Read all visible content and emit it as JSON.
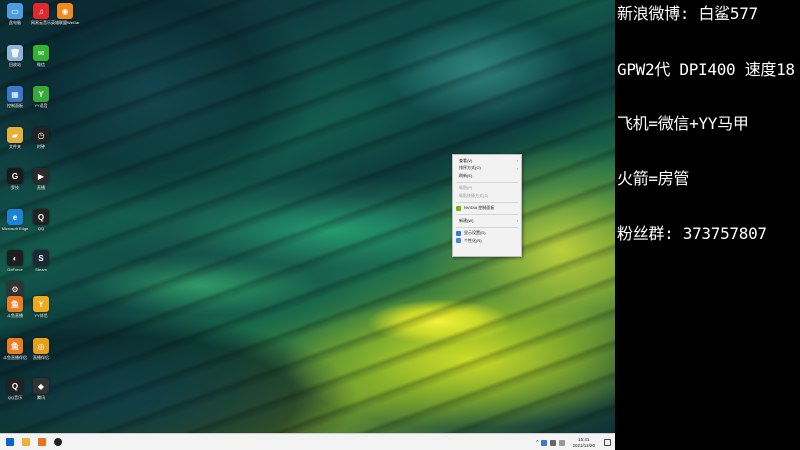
{
  "desktop": {
    "icons": [
      {
        "label": "此电脑",
        "color": "#4a9ee0",
        "glyph": "▭"
      },
      {
        "label": "网易云音乐",
        "color": "#e0282f",
        "glyph": "♫"
      },
      {
        "label": "英雄联盟WeGame",
        "color": "#f08a1c",
        "glyph": "◉"
      },
      {
        "label": "回收站",
        "color": "#8fb5d9",
        "glyph": "🗑"
      },
      {
        "label": "微信",
        "color": "#33b233",
        "glyph": "✉"
      },
      {
        "label": "控制面板",
        "color": "#3a78c8",
        "glyph": "▦"
      },
      {
        "label": "YY语音",
        "color": "#39a83a",
        "glyph": "Y"
      },
      {
        "label": "文件夹",
        "color": "#e2b13a",
        "glyph": "▰"
      },
      {
        "label": "时钟",
        "color": "#222",
        "glyph": "◷"
      },
      {
        "label": "罗技",
        "color": "#1a1a1a",
        "glyph": "G"
      },
      {
        "label": "直播",
        "color": "#2a2a2a",
        "glyph": "▶"
      },
      {
        "label": "Microsoft Edge",
        "color": "#1883d7",
        "glyph": "e"
      },
      {
        "label": "QQ",
        "color": "#222",
        "glyph": "Q"
      },
      {
        "label": "GeForce",
        "color": "#1e1e1e",
        "glyph": "◐"
      },
      {
        "label": "Steam",
        "color": "#1b2838",
        "glyph": "S"
      },
      {
        "label": "快捷方式",
        "color": "#333",
        "glyph": "⚙"
      },
      {
        "label": "斗鱼直播",
        "color": "#f07c22",
        "glyph": "鱼"
      },
      {
        "label": "YY伴侣",
        "color": "#f0a91c",
        "glyph": "Y"
      },
      {
        "label": "斗鱼直播伴侣",
        "color": "#f07c22",
        "glyph": "鱼"
      },
      {
        "label": "直播伴侣",
        "color": "#e8a01c",
        "glyph": "◎"
      },
      {
        "label": "QQ音乐",
        "color": "#222",
        "glyph": "Q"
      },
      {
        "label": "腾讯",
        "color": "#333",
        "glyph": "◆"
      }
    ]
  },
  "context_menu": {
    "items": [
      {
        "label": "查看(V)",
        "has_submenu": true,
        "disabled": false
      },
      {
        "label": "排序方式(O)",
        "has_submenu": true,
        "disabled": false
      },
      {
        "label": "刷新(E)",
        "has_submenu": false,
        "disabled": false
      },
      {
        "label": "粘贴(P)",
        "has_submenu": false,
        "disabled": true
      },
      {
        "label": "粘贴快捷方式(S)",
        "has_submenu": false,
        "disabled": true
      },
      {
        "label": "NVIDIA 控制面板",
        "has_submenu": false,
        "disabled": false
      },
      {
        "label": "新建(W)",
        "has_submenu": true,
        "disabled": false
      },
      {
        "label": "显示设置(D)",
        "has_submenu": false,
        "disabled": false
      },
      {
        "label": "个性化(R)",
        "has_submenu": false,
        "disabled": false
      }
    ],
    "icon_colors": {
      "nvidia": "#76b900",
      "display": "#2f7bd6",
      "personalize": "#3c8be0"
    }
  },
  "taskbar": {
    "apps": [
      {
        "name": "windows-start-icon",
        "color": "#0a64c8"
      },
      {
        "name": "explorer-icon",
        "color": "#e8b13a"
      },
      {
        "name": "app-orange-icon",
        "color": "#e8741c"
      },
      {
        "name": "app-dark-icon",
        "color": "#222222"
      }
    ],
    "tray_arrow": "^",
    "clock_time": "15:41",
    "clock_date": "2021/12/20"
  },
  "overlay": {
    "lines": [
      "新浪微博: 白鲨577",
      "GPW2代 DPI400 速度18",
      "飞机=微信+YY马甲",
      "火箭=房管",
      "粉丝群: 373757807"
    ]
  }
}
